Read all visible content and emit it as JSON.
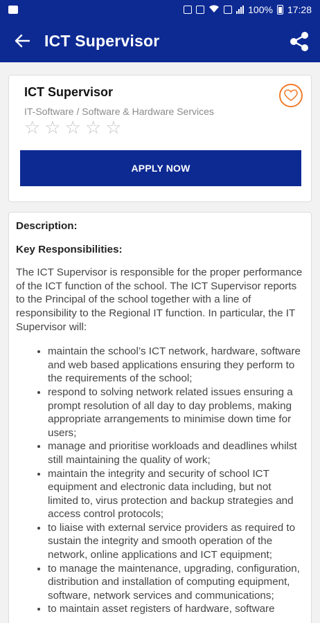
{
  "status_bar": {
    "battery": "100%",
    "time": "17:28"
  },
  "app_bar": {
    "title": "ICT Supervisor",
    "back_icon": "arrow-left-icon",
    "share_icon": "share-icon"
  },
  "job": {
    "title": "ICT Supervisor",
    "category": "IT-Software / Software & Hardware Services",
    "rating": 0,
    "max_rating": 5,
    "apply_label": "APPLY NOW",
    "favorite_icon": "heart-icon",
    "accent": "#0d2a93",
    "favorite_color": "#f07c2a"
  },
  "description": {
    "label": "Description:",
    "key_label": "Key Responsibilities:",
    "intro": "The ICT Supervisor is responsible for the proper performance of the ICT function of the school. The ICT Supervisor reports to the Principal of the school together with a line of responsibility to the Regional IT function. In particular, the IT Supervisor will:",
    "responsibilities": [
      "maintain the school’s ICT network, hardware, software and web based applications ensuring they perform to the requirements of the school;",
      "respond to solving network related issues ensuring a prompt resolution of all day to day problems, making appropriate arrangements to minimise down time for users;",
      "manage and prioritise workloads and deadlines whilst still maintaining the quality of work;",
      "maintain the integrity and security of school ICT equipment and electronic data including, but not limited to, virus protection and backup strategies and access control protocols;",
      "to liaise with external service providers as required to sustain the integrity and smooth operation of the network, online applications and ICT equipment;",
      "to manage the maintenance, upgrading, configuration, distribution and installation of computing equipment, software, network services and communications;",
      "to maintain asset registers of hardware, software"
    ]
  }
}
